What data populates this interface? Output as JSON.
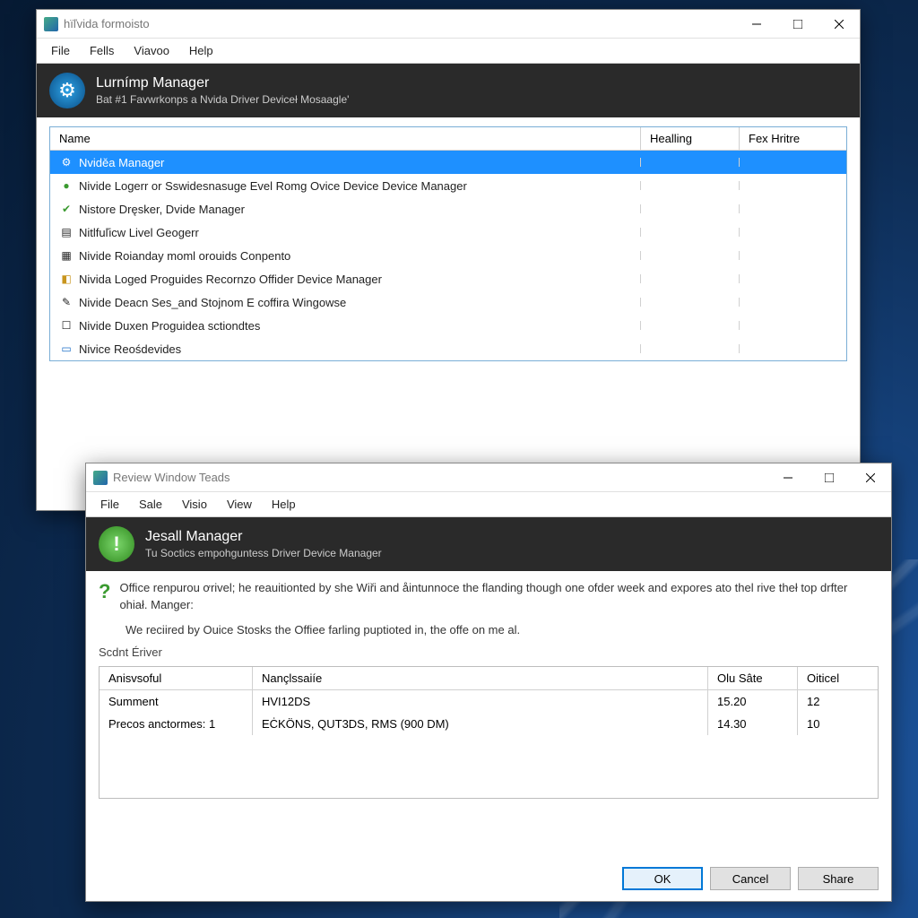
{
  "window1": {
    "title": "hïľvida formoisto",
    "menu": [
      "File",
      "Fells",
      "Viavoo",
      "Help"
    ],
    "header": {
      "title": "Lurnímp Manager",
      "subtitle": "Bat #1 Favwrkonps a Nvida Driver Deviceł Mosaagle'"
    },
    "columns": {
      "name": "Name",
      "healling": "Healling",
      "fex": "Fex Hritre"
    },
    "rows": [
      {
        "label": "Nviděa Manager",
        "selected": true,
        "icon": "gear"
      },
      {
        "label": "Nivide Logerr or Sswidesnasuge Evel Romg Ovice Device Device Manager",
        "icon": "dot-green"
      },
      {
        "label": "Nistore Dręsker, Dvide Manager",
        "icon": "check-green"
      },
      {
        "label": "Nitlfuľicw Livel Geogerr",
        "icon": "page"
      },
      {
        "label": "Nivide Roianday moml orouids Conpento",
        "icon": "page-lines"
      },
      {
        "label": "Nivida Loged Proguides Recornzo Offider Device Manager",
        "icon": "box-gold"
      },
      {
        "label": "Nivide Deacn Ses_and Stojnom E coffira Wingowse",
        "icon": "wand"
      },
      {
        "label": "Nivide Duxen Proguidea sctiondtes",
        "icon": "box-white"
      },
      {
        "label": "Nivice Reośdevides",
        "icon": "window-blue"
      }
    ]
  },
  "window2": {
    "title": "Review Window Teads",
    "menu": [
      "File",
      "Sale",
      "Visio",
      "View",
      "Help"
    ],
    "header": {
      "title": "Jesall Manager",
      "subtitle": "Tu Soctics empohguntess Driver Device Manager"
    },
    "message1": "Office renpurou ơrivel; he reauitionted by she Wiři and åintunnoce the flanding though one ofder week and expores ato thel rive theł top drfter ohiał. Manger:",
    "message2": "We reciired by Ouice Stosks the Offiee farling puptioted in, the offe on me al.",
    "section_title": "Scdnt Ériver",
    "grid": {
      "columns": {
        "a": "Anisvsoful",
        "n": "Nançlssaiíe",
        "o": "Olu Sâte",
        "f": "Oiticel"
      },
      "rows": [
        {
          "a": "Summent",
          "n": "HVI12DS",
          "o": "15.20",
          "f": "12"
        },
        {
          "a": "Precos anctormes:  1",
          "n": "ЕĊKÖNS, QUT3DS, RМS (900 DM)",
          "o": "14.30",
          "f": "10"
        }
      ]
    },
    "buttons": {
      "ok": "OK",
      "cancel": "Cancel",
      "share": "Share"
    }
  }
}
